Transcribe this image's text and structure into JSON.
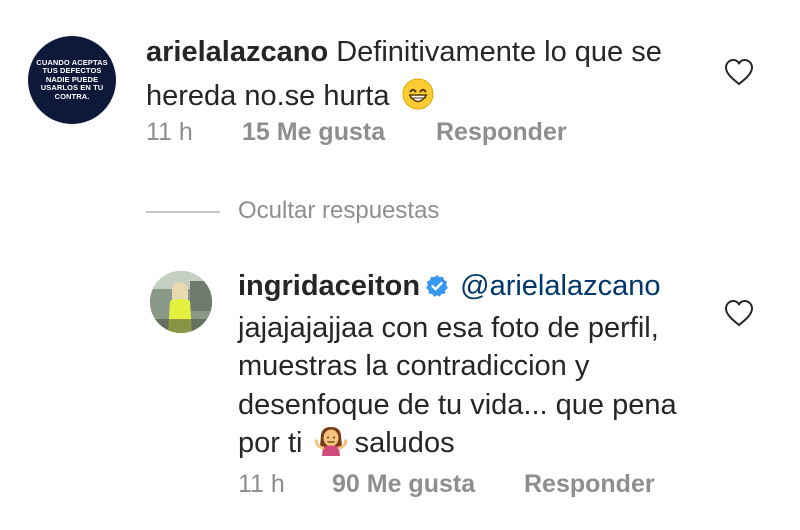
{
  "comment": {
    "avatar_text": "CUANDO ACEPTAS TUS DEFECTOS NADIE PUEDE USARLOS EN TU CONTRA.",
    "username": "arielalazcano",
    "text": "Definitivamente lo que se hereda no.se hurta",
    "emoji_icon": "grinning-smiling-eyes-emoji",
    "time": "11 h",
    "likes": "15 Me gusta",
    "reply_label": "Responder",
    "like_icon": "heart-outline-icon"
  },
  "hide_replies_label": "Ocultar respuestas",
  "reply": {
    "username": "ingridaceiton",
    "verified_icon": "verified-badge-icon",
    "mention": "@arielalazcano",
    "text_before_emoji": "jajajajajjaa con esa foto de perfil, muestras  la contradiccion y desenfoque de tu vida... que pena por ti",
    "emoji_icon": "person-shrugging-emoji",
    "text_after_emoji": "saludos",
    "time": "11 h",
    "likes": "90 Me gusta",
    "reply_label": "Responder",
    "like_icon": "heart-outline-icon"
  },
  "colors": {
    "text": "#262626",
    "secondary": "#8e8e8e",
    "mention": "#00376b",
    "verified": "#3897f0",
    "avatar_bg": "#0e1838"
  }
}
